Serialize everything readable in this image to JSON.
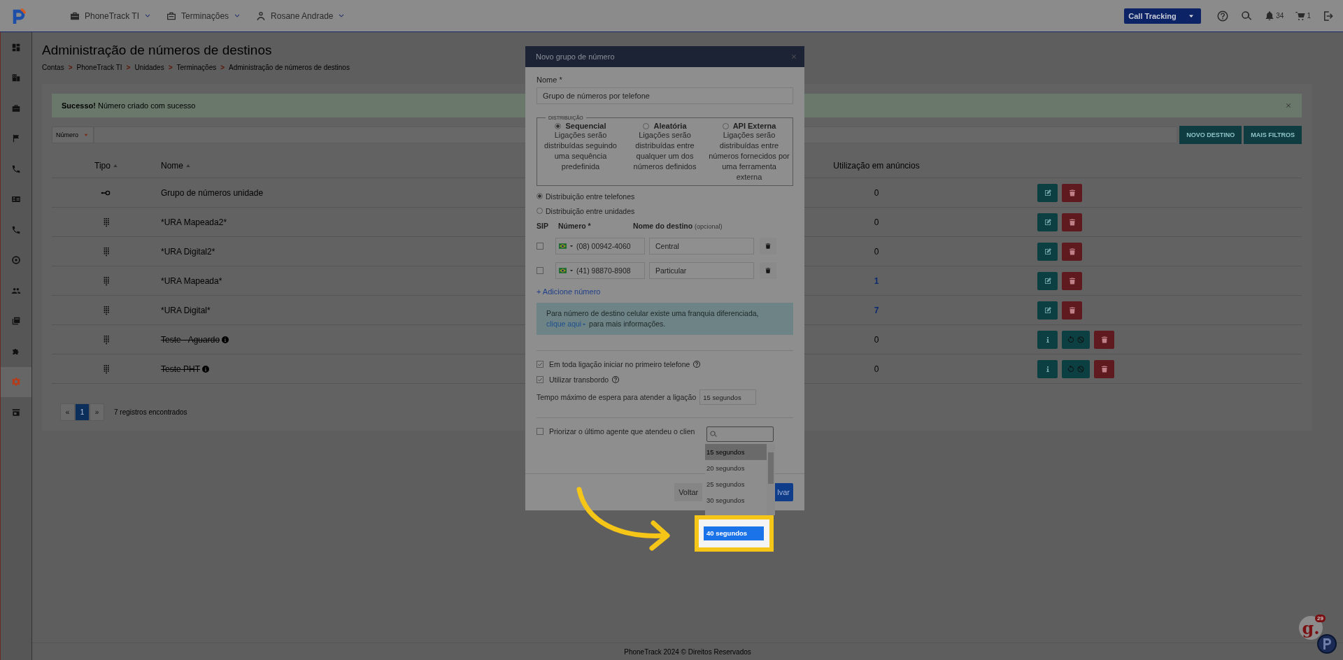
{
  "topbar": {
    "menus": [
      {
        "label": "PhoneTrack TI"
      },
      {
        "label": "Terminações"
      },
      {
        "label": "Rosane Andrade"
      }
    ],
    "product": "Call Tracking",
    "notifications": "34",
    "cart": "1"
  },
  "sidebar": {
    "items": [
      {
        "selected": false
      },
      {
        "selected": false
      },
      {
        "selected": false
      },
      {
        "selected": false
      },
      {
        "selected": false
      },
      {
        "selected": false
      },
      {
        "selected": false
      },
      {
        "selected": false
      },
      {
        "selected": false
      },
      {
        "selected": false
      },
      {
        "selected": false
      },
      {
        "selected": true
      },
      {
        "selected": false
      }
    ]
  },
  "page": {
    "title": "Administração de números de destinos",
    "breadcrumb": [
      "Contas",
      "PhoneTrack TI",
      "Unidades",
      "Terminações",
      "Administração de números de destinos"
    ],
    "breadcrumb_separator": ">"
  },
  "alert": {
    "message": "**Sucesso!** Número criado com sucesso"
  },
  "filter": {
    "field": "Número"
  },
  "actions": [
    "NOVO DESTINO",
    "MAIS FILTROS"
  ],
  "table": {
    "columns": [
      {
        "label": "Tipo",
        "sortable": true
      },
      {
        "label": "Nome",
        "sortable": true
      },
      {
        "label": "Utilização em anúncios",
        "sortable": false
      }
    ],
    "rows": [
      {
        "kind": "group",
        "name": "Grupo de números unidade",
        "usage": "0",
        "usage_link": false,
        "disabled": false
      },
      {
        "kind": "keypad",
        "name": "*URA Mapeada2*",
        "usage": "0",
        "usage_link": false,
        "disabled": false
      },
      {
        "kind": "keypad",
        "name": "*URA Digital2*",
        "usage": "0",
        "usage_link": false,
        "disabled": false
      },
      {
        "kind": "keypad",
        "name": "*URA Mapeada*",
        "usage": "1",
        "usage_link": true,
        "disabled": false
      },
      {
        "kind": "keypad",
        "name": "*URA Digital*",
        "usage": "7",
        "usage_link": true,
        "disabled": false
      },
      {
        "kind": "keypad",
        "name": "Teste - Aguardo",
        "usage": "0",
        "usage_link": false,
        "disabled": true
      },
      {
        "kind": "keypad",
        "name": "Teste PHT",
        "usage": "0",
        "usage_link": false,
        "disabled": true
      }
    ]
  },
  "pagination": {
    "prev": "«",
    "next": "»",
    "pages": [
      {
        "label": "1",
        "selected": true
      }
    ],
    "summary": "7 registros encontrados"
  },
  "footer": "PhoneTrack 2024 © Direitos Reservados",
  "chat_widget": {
    "label": "g.",
    "count": "29"
  },
  "modal": {
    "title": "Novo grupo de número",
    "name_label": "Nome *",
    "name_value": "Grupo de números por telefone",
    "distribution_legend": "DISTRIBUIÇÃO",
    "distributions": [
      {
        "label": "Sequencial",
        "description": "Ligações serão distribuídas seguindo uma sequência predefinida",
        "selected": true
      },
      {
        "label": "Aleatória",
        "description": "Ligações serão distribuídas entre qualquer um dos números definidos",
        "selected": false
      },
      {
        "label": "API Externa",
        "description": "Ligações serão distribuídas entre números fornecidos por uma ferramenta externa",
        "selected": false
      }
    ],
    "scopes": [
      {
        "label": "Distribuição entre telefones",
        "selected": true
      },
      {
        "label": "Distribuição entre unidades",
        "selected": false
      }
    ],
    "dest_columns": {
      "sip": "SIP",
      "number": "Número *",
      "name": "Nome do destino",
      "name_hint": "(opcional)"
    },
    "destinations": [
      {
        "sip": false,
        "number": "(08) 00942-4060",
        "name": "Central"
      },
      {
        "sip": false,
        "number": "(41) 98870-8908",
        "name": "Particular"
      }
    ],
    "add_link": "+ Adicione número",
    "notice": {
      "before": "Para número de destino celular existe uma franquia diferenciada,",
      "link": "clique aqui",
      "after": "para mais informações."
    },
    "options": [
      {
        "label": "Em toda ligação iniciar no primeiro telefone",
        "checked": true,
        "help": true
      },
      {
        "label": "Utilizar transbordo",
        "checked": true,
        "help": true
      }
    ],
    "wait_label": "Tempo máximo de espera para atender a ligação",
    "wait_value": "15 segundos",
    "prioritize": {
      "label": "Priorizar o último agente que atendeu o clien",
      "checked": false
    },
    "back": "Voltar",
    "save": "lvar"
  },
  "dropdown": {
    "options": [
      {
        "label": "15 segundos",
        "selected": true,
        "highlighted": false
      },
      {
        "label": "20 segundos",
        "selected": false,
        "highlighted": false
      },
      {
        "label": "25 segundos",
        "selected": false,
        "highlighted": false
      },
      {
        "label": "30 segundos",
        "selected": false,
        "highlighted": false
      },
      {
        "label": "40 segundos",
        "selected": false,
        "highlighted": true
      }
    ]
  }
}
